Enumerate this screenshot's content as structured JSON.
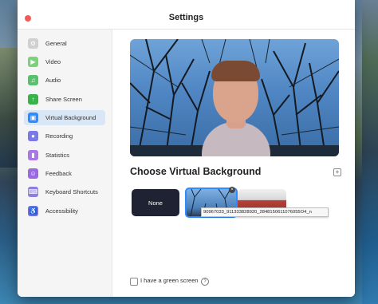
{
  "window": {
    "title": "Settings"
  },
  "sidebar": {
    "items": [
      {
        "label": "General",
        "icon": "gear-icon",
        "color": "#d0d0d0",
        "active": false
      },
      {
        "label": "Video",
        "icon": "video-icon",
        "color": "#7bd27b",
        "active": false
      },
      {
        "label": "Audio",
        "icon": "headphones-icon",
        "color": "#58c16b",
        "active": false
      },
      {
        "label": "Share Screen",
        "icon": "share-screen-icon",
        "color": "#39b24a",
        "active": false
      },
      {
        "label": "Virtual Background",
        "icon": "virtual-background-icon",
        "color": "#2d8cff",
        "active": true
      },
      {
        "label": "Recording",
        "icon": "recording-icon",
        "color": "#7a79e6",
        "active": false
      },
      {
        "label": "Statistics",
        "icon": "statistics-icon",
        "color": "#a977e8",
        "active": false
      },
      {
        "label": "Feedback",
        "icon": "feedback-icon",
        "color": "#9a6be0",
        "active": false
      },
      {
        "label": "Keyboard Shortcuts",
        "icon": "keyboard-icon",
        "color": "#8e7fde",
        "active": false
      },
      {
        "label": "Accessibility",
        "icon": "accessibility-icon",
        "color": "#6f6fe0",
        "active": false
      }
    ]
  },
  "main": {
    "section_title": "Choose Virtual Background",
    "backgrounds": {
      "none_label": "None",
      "tooltip": "90967033_911333828920_2848150611076055O4_n"
    },
    "green_screen": {
      "label": "I have a green screen",
      "checked": false
    }
  },
  "colors": {
    "accent": "#2d8cff",
    "close": "#f25a57"
  }
}
